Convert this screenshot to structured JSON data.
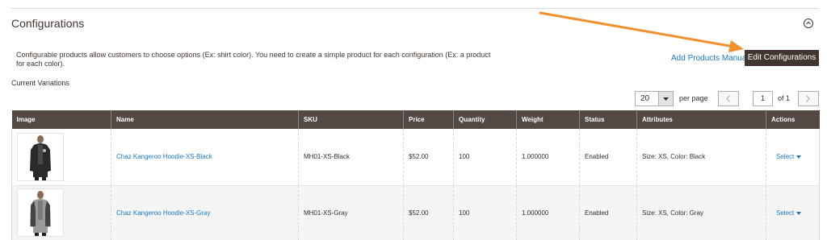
{
  "section": {
    "title": "Configurations",
    "description": "Configurable products allow customers to choose options (Ex: shirt color). You need to create a simple product for each configuration (Ex: a product for each color).",
    "add_products_manually": "Add Products Manually",
    "edit_configurations": "Edit Configurations",
    "current_variations": "Current Variations",
    "collapse_icon": "chevron-up-icon"
  },
  "pager": {
    "per_page_value": "20",
    "per_page_label": "per page",
    "current_page": "1",
    "of_label": "of 1"
  },
  "colors": {
    "header_bg": "#514943",
    "primary_button": "#41362f",
    "link": "#1979c3",
    "annotation_arrow": "#f0912e"
  },
  "table": {
    "columns": [
      "Image",
      "Name",
      "SKU",
      "Price",
      "Quantity",
      "Weight",
      "Status",
      "Attributes",
      "Actions"
    ],
    "rows": [
      {
        "image": "hoodie-black-thumbnail",
        "name": "Chaz Kangeroo Hoodie-XS-Black",
        "sku": "MH01-XS-Black",
        "price": "$52.00",
        "quantity": "100",
        "weight": "1.000000",
        "status": "Enabled",
        "attributes": "Size: XS, Color: Black",
        "action": "Select"
      },
      {
        "image": "hoodie-gray-thumbnail",
        "name": "Chaz Kangeroo Hoodie-XS-Gray",
        "sku": "MH01-XS-Gray",
        "price": "$52.00",
        "quantity": "100",
        "weight": "1.000000",
        "status": "Enabled",
        "attributes": "Size: XS, Color: Gray",
        "action": "Select"
      }
    ]
  }
}
